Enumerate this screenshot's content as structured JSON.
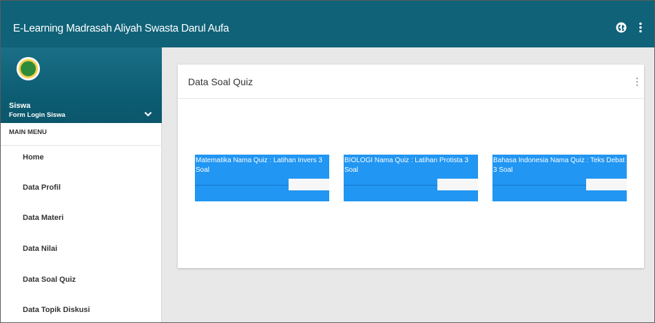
{
  "app": {
    "title": "E-Learning Madrasah Aliyah Swasta Darul Aufa"
  },
  "topbar": {
    "icons": [
      "globe-icon",
      "more-vert-icon"
    ]
  },
  "user": {
    "name": "Siswa",
    "subtitle": "Form Login Siswa"
  },
  "sidebar": {
    "menu_header": "MAIN MENU",
    "items": [
      {
        "label": "Home"
      },
      {
        "label": "Data Profil"
      },
      {
        "label": "Data Materi"
      },
      {
        "label": "Data Nilai"
      },
      {
        "label": "Data Soal Quiz"
      },
      {
        "label": "Data Topik Diskusi"
      }
    ]
  },
  "main": {
    "card_title": "Data Soal Quiz",
    "quizzes": [
      {
        "text": "Matematika Nama Quiz : Latihan Invers 3 Soal"
      },
      {
        "text": "BIOLOGI Nama Quiz : Latihan Protista 3 Soal"
      },
      {
        "text": "Bahasa Indonesia Nama Quiz : Teks Debat 3 Soal"
      }
    ]
  },
  "colors": {
    "topbar": "#0f6278",
    "quiz_tile": "#2196f3",
    "background": "#e8e8e8"
  }
}
